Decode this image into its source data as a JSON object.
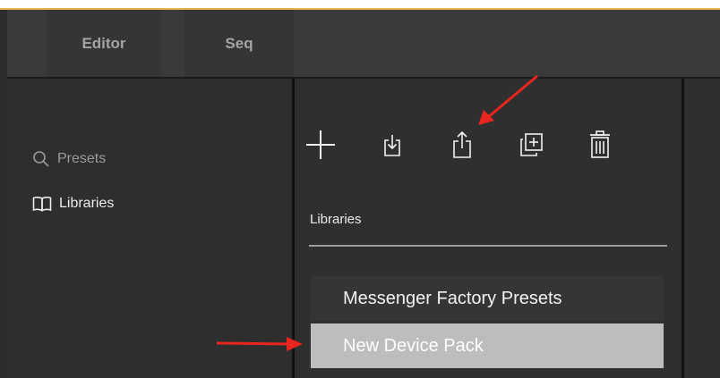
{
  "header": {
    "tabs": [
      {
        "label": "Editor"
      },
      {
        "label": "Seq"
      }
    ]
  },
  "sidebar": {
    "items": [
      {
        "label": "Presets",
        "icon": "search-icon"
      },
      {
        "label": "Libraries",
        "icon": "book-icon"
      }
    ]
  },
  "panel": {
    "toolbar": {
      "icons": [
        "plus-icon",
        "import-icon",
        "share-icon",
        "duplicate-icon",
        "trash-icon"
      ]
    },
    "section_label": "Libraries",
    "libraries": [
      {
        "label": "Messenger Factory Presets"
      },
      {
        "label": "New Device Pack",
        "selected": true
      }
    ]
  },
  "colors": {
    "accent_bar": "#e8b24a",
    "annotation_arrow": "#e8251f",
    "selected_item": "#bdbdbd"
  }
}
